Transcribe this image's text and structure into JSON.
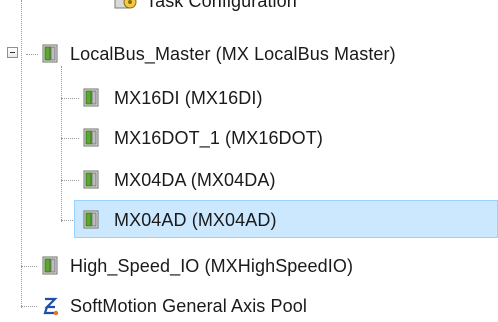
{
  "tree": {
    "items": [
      {
        "label": "Task Configuration",
        "icon": "task-config-icon"
      },
      {
        "label": "LocalBus_Master (MX LocalBus Master)",
        "icon": "device-module-icon",
        "expanded": true
      },
      {
        "label": "MX16DI (MX16DI)",
        "icon": "device-module-icon"
      },
      {
        "label": "MX16DOT_1 (MX16DOT)",
        "icon": "device-module-icon"
      },
      {
        "label": "MX04DA (MX04DA)",
        "icon": "device-module-icon"
      },
      {
        "label": "MX04AD (MX04AD)",
        "icon": "device-module-icon",
        "selected": true
      },
      {
        "label": "High_Speed_IO (MXHighSpeedIO)",
        "icon": "device-module-icon"
      },
      {
        "label": "SoftMotion General Axis Pool",
        "icon": "axis-pool-icon"
      }
    ]
  },
  "colors": {
    "selection_bg": "#cce8ff",
    "selection_border": "#99d1ff",
    "module_icon_green": "#5aa832",
    "axis_icon_blue": "#1f4fa8",
    "axis_icon_orange": "#e07a1c"
  }
}
